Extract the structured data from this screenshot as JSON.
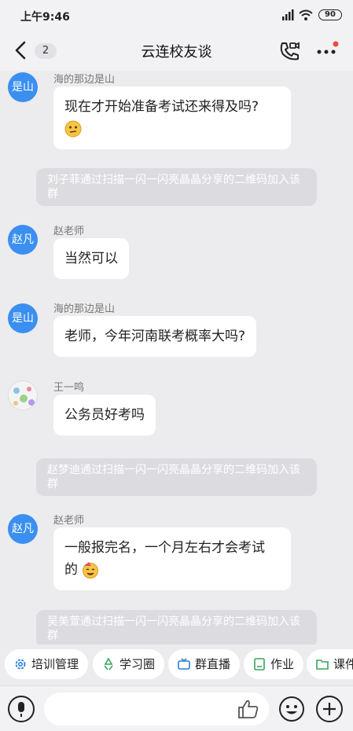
{
  "status": {
    "time": "上午9:46",
    "battery": "90"
  },
  "header": {
    "unread_badge": "2",
    "title": "云连校友谈"
  },
  "messages": [
    {
      "avatar_text": "是山",
      "sender": "海的那边是山",
      "text": "现在才开始准备考试还来得及吗?"
    },
    {
      "system": "刘子菲通过扫描一闪一闪亮晶晶分享的二维码加入该群"
    },
    {
      "avatar_text": "赵凡",
      "sender": "赵老师",
      "text": "当然可以"
    },
    {
      "avatar_text": "是山",
      "sender": "海的那边是山",
      "text": "老师，今年河南联考概率大吗?"
    },
    {
      "sender": "王一鸣",
      "text": "公务员好考吗"
    },
    {
      "system": "赵梦迪通过扫描一闪一闪亮晶晶分享的二维码加入该群"
    },
    {
      "avatar_text": "赵凡",
      "sender": "赵老师",
      "text_line1": "一般报完名，一个月左右才会考试",
      "text_line2": "的"
    },
    {
      "system": "吴美萱通过扫描一闪一闪亮晶晶分享的二维码加入该群"
    }
  ],
  "tools": [
    "培训管理",
    "学习圈",
    "群直播",
    "作业",
    "课件"
  ]
}
